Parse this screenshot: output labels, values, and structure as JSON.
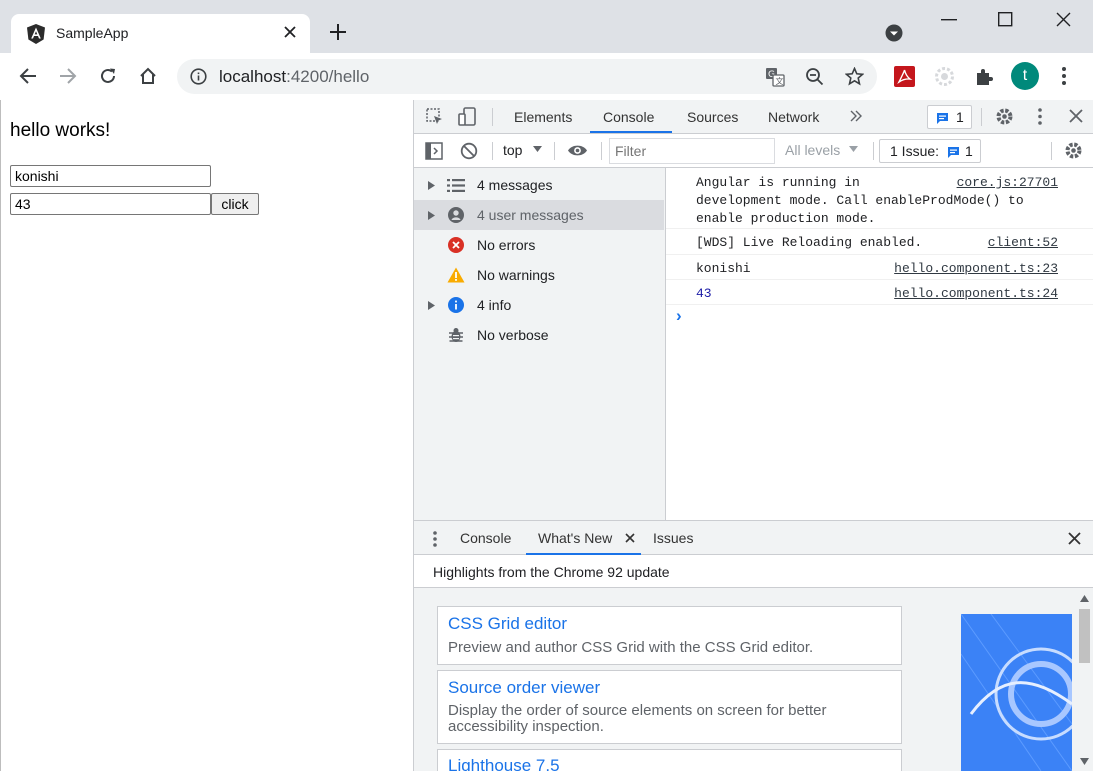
{
  "browser": {
    "tab_title": "SampleApp",
    "url_host": "localhost",
    "url_rest": ":4200/hello",
    "profile_initial": "t",
    "accent": "#1a73e8"
  },
  "page": {
    "heading": "hello works!",
    "name_value": "konishi",
    "number_value": "43",
    "button_label": "click"
  },
  "devtools": {
    "tabs": [
      "Elements",
      "Console",
      "Sources",
      "Network"
    ],
    "active_tab": "Console",
    "issues_count": "1",
    "context": "top",
    "filter_placeholder": "Filter",
    "levels": "All levels",
    "issue_label": "1 Issue:",
    "issue_count": "1",
    "sidebar": [
      {
        "label": "4 messages",
        "icon": "list-icon"
      },
      {
        "label": "4 user messages",
        "icon": "user-icon"
      },
      {
        "label": "No errors",
        "icon": "error-icon"
      },
      {
        "label": "No warnings",
        "icon": "warning-icon"
      },
      {
        "label": "4 info",
        "icon": "info-icon"
      },
      {
        "label": "No verbose",
        "icon": "bug-icon"
      }
    ],
    "messages": [
      {
        "line1": "Angular is running in",
        "line2": "development mode. Call enableProdMode() to",
        "line3": "enable production mode.",
        "source": "core.js:27701"
      },
      {
        "text": "[WDS] Live Reloading enabled.",
        "source": "client:52"
      },
      {
        "text": "konishi",
        "source": "hello.component.ts:23"
      },
      {
        "text": "43",
        "source": "hello.component.ts:24"
      }
    ],
    "prompt": "›",
    "drawer_tabs": [
      "Console",
      "What's New",
      "Issues"
    ],
    "drawer_active": "What's New",
    "highlights": "Highlights from the Chrome 92 update",
    "cards": [
      {
        "title": "CSS Grid editor",
        "desc": "Preview and author CSS Grid with the CSS Grid editor."
      },
      {
        "title": "Source order viewer",
        "desc1": "Display the order of source elements on screen for better",
        "desc2": "accessibility inspection."
      },
      {
        "title": "Lighthouse 7.5"
      }
    ]
  }
}
